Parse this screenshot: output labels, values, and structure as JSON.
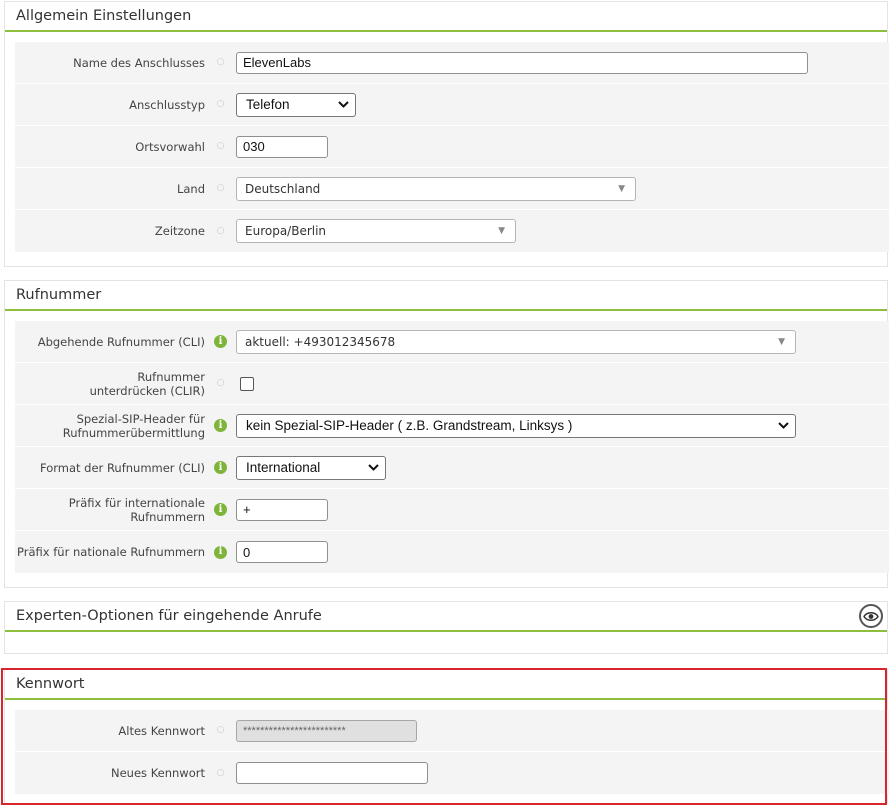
{
  "general": {
    "title": "Allgemein Einstellungen",
    "connection_name_label": "Name des Anschlusses",
    "connection_name_value": "ElevenLabs",
    "connection_type_label": "Anschlusstyp",
    "connection_type_value": "Telefon",
    "area_code_label": "Ortsvorwahl",
    "area_code_value": "030",
    "country_label": "Land",
    "country_value": "Deutschland",
    "timezone_label": "Zeitzone",
    "timezone_value": "Europa/Berlin"
  },
  "number": {
    "title": "Rufnummer",
    "cli_label": "Abgehende Rufnummer (CLI)",
    "cli_value": "aktuell: +493012345678",
    "clir_label": "Rufnummer unterdrücken (CLIR)",
    "sip_header_label": "Spezial-SIP-Header für Rufnummerübermittlung",
    "sip_header_value": "kein Spezial-SIP-Header ( z.B. Grandstream, Linksys )",
    "format_label": "Format der Rufnummer (CLI)",
    "format_value": "International",
    "intl_prefix_label": "Präfix für internationale Rufnummern",
    "intl_prefix_value": "+",
    "natl_prefix_label": "Präfix für nationale Rufnummern",
    "natl_prefix_value": "0"
  },
  "expert": {
    "title": "Experten-Optionen für eingehende Anrufe"
  },
  "password": {
    "title": "Kennwort",
    "old_label": "Altes Kennwort",
    "old_value": "************************",
    "new_label": "Neues Kennwort",
    "new_value": ""
  },
  "colors": {
    "accent_green": "#8bbf3d",
    "info_green": "#7fb43a",
    "highlight_red": "#d9262c"
  },
  "icons": {
    "hint": "hint-dot-icon",
    "info": "info-icon",
    "dropdown": "chevron-down-icon",
    "expand": "eye-icon"
  }
}
